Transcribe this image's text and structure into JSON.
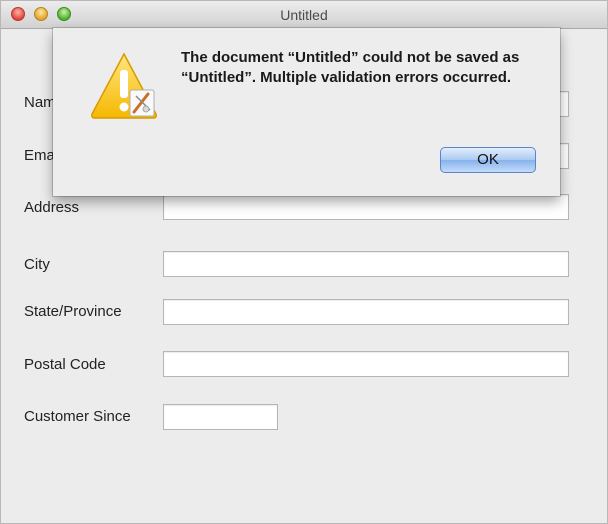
{
  "window": {
    "title": "Untitled"
  },
  "form": {
    "name_label": "Name",
    "email_label": "Email",
    "address_label": "Address",
    "city_label": "City",
    "state_label": "State/Province",
    "postal_label": "Postal Code",
    "customer_since_label": "Customer Since"
  },
  "alert": {
    "message": "The document “Untitled” could not be saved as “Untitled”. Multiple validation errors occurred.",
    "ok_label": "OK"
  }
}
